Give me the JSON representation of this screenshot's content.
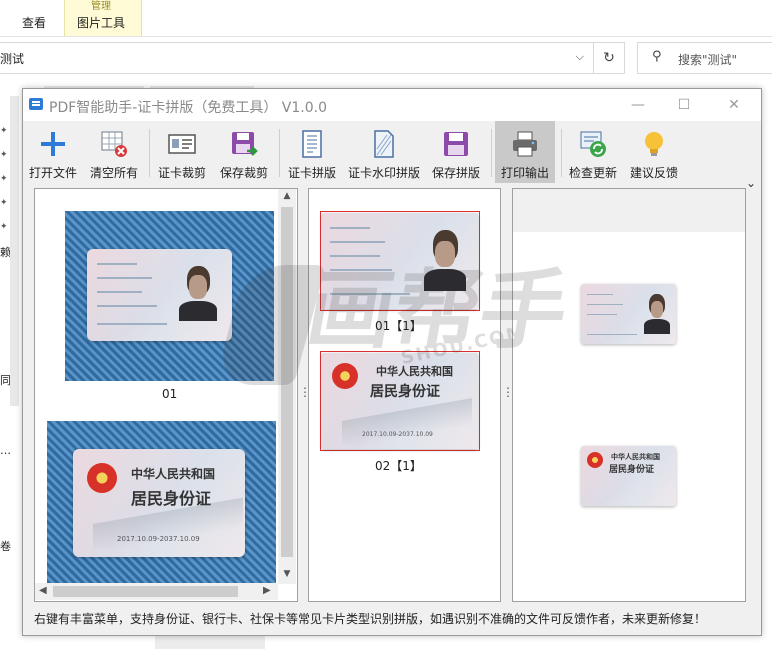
{
  "explorer": {
    "ribbon_tabs": [
      "查看",
      "图片工具"
    ],
    "context_group_label": "管理",
    "address_text": "测试",
    "search_placeholder": "搜索\"测试\"",
    "left_fragments": [
      "赖",
      "同",
      "…",
      "卷"
    ]
  },
  "window": {
    "title": "PDF智能助手-证卡拼版（免费工具） V1.0.0",
    "controls": {
      "minimize": "—",
      "maximize": "☐",
      "close": "✕"
    }
  },
  "toolbar": {
    "items": [
      {
        "label": "打开文件",
        "icon": "plus-icon"
      },
      {
        "label": "清空所有",
        "icon": "clear-grid-icon"
      },
      {
        "label": "证卡裁剪",
        "icon": "id-card-icon"
      },
      {
        "label": "保存裁剪",
        "icon": "save-arrow-icon"
      },
      {
        "label": "证卡拼版",
        "icon": "document-icon"
      },
      {
        "label": "证卡水印拼版",
        "icon": "watermark-document-icon"
      },
      {
        "label": "保存拼版",
        "icon": "save-icon"
      },
      {
        "label": "打印输出",
        "icon": "printer-icon"
      },
      {
        "label": "检查更新",
        "icon": "update-icon"
      },
      {
        "label": "建议反馈",
        "icon": "lightbulb-icon"
      }
    ],
    "overflow": "⌄",
    "active": "打印输出"
  },
  "source_panel": {
    "items": [
      {
        "caption": "01"
      }
    ],
    "card_front_title1": "中华人民共和国",
    "card_front_title2": "居民身份证",
    "card_validity": "2017.10.09-2037.10.09"
  },
  "cropped_panel": {
    "items": [
      {
        "caption": "01【1】"
      },
      {
        "caption": "02【1】"
      }
    ]
  },
  "status": {
    "text": "右键有丰富菜单，支持身份证、银行卡、社保卡等常见卡片类型识别拼版，如遇识别不准确的文件可反馈作者，未来更新修复！"
  },
  "watermark": {
    "main": "画帮手",
    "sub": "SHOU.COM"
  },
  "colors": {
    "accent_blue": "#2d7bd6",
    "selection_red": "#e03030",
    "active_button": "#c9c9c9"
  }
}
